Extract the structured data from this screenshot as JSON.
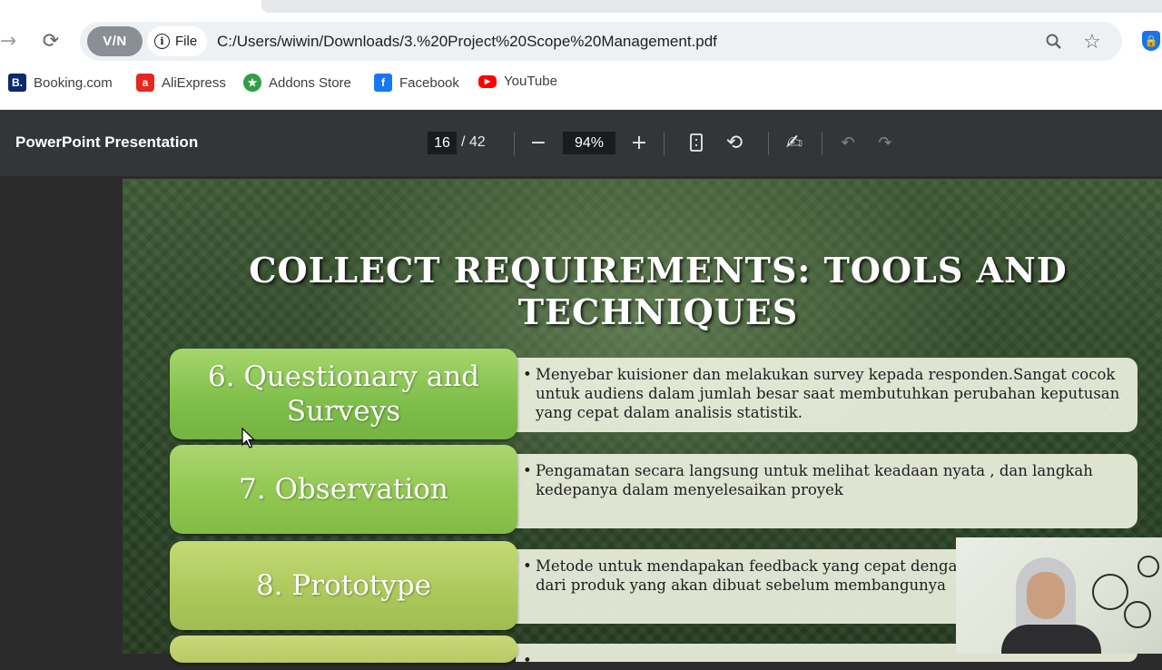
{
  "browser": {
    "vpn_label": "V/N",
    "file_chip": "File",
    "url": "C:/Users/wiwin/Downloads/3.%20Project%20Scope%20Management.pdf",
    "bookmarks": [
      {
        "label": "Booking.com",
        "icon": "B."
      },
      {
        "label": "AliExpress",
        "icon": "a"
      },
      {
        "label": "Addons Store",
        "icon": "★"
      },
      {
        "label": "Facebook",
        "icon": "f"
      },
      {
        "label": "YouTube",
        "icon": "▶"
      }
    ]
  },
  "pdf_toolbar": {
    "title": "PowerPoint Presentation",
    "page_current": "16",
    "page_total": "/ 42",
    "zoom": "94%"
  },
  "slide": {
    "title_line1": "COLLECT REQUIREMENTS: TOOLS AND",
    "title_line2": "TECHNIQUES",
    "items": [
      {
        "label": "6. Questionary and Surveys",
        "description": "Menyebar kuisioner dan melakukan survey kepada responden.Sangat cocok untuk audiens dalam jumlah besar saat membutuhkan perubahan keputusan yang cepat dalam analisis statistik."
      },
      {
        "label": "7. Observation",
        "description": "Pengamatan secara langsung untuk melihat keadaan nyata , dan langkah kedepanya dalam menyelesaikan proyek"
      },
      {
        "label": "8. Prototype",
        "description": "Metode untuk mendapakan feedback yang cepat dengan rancangan kerja dari produk yang akan dibuat sebelum membangunya"
      }
    ]
  },
  "colors": {
    "toolbar_bg": "#323639",
    "slide_green": "#2d4628",
    "label_green": "#7fbe4a"
  }
}
